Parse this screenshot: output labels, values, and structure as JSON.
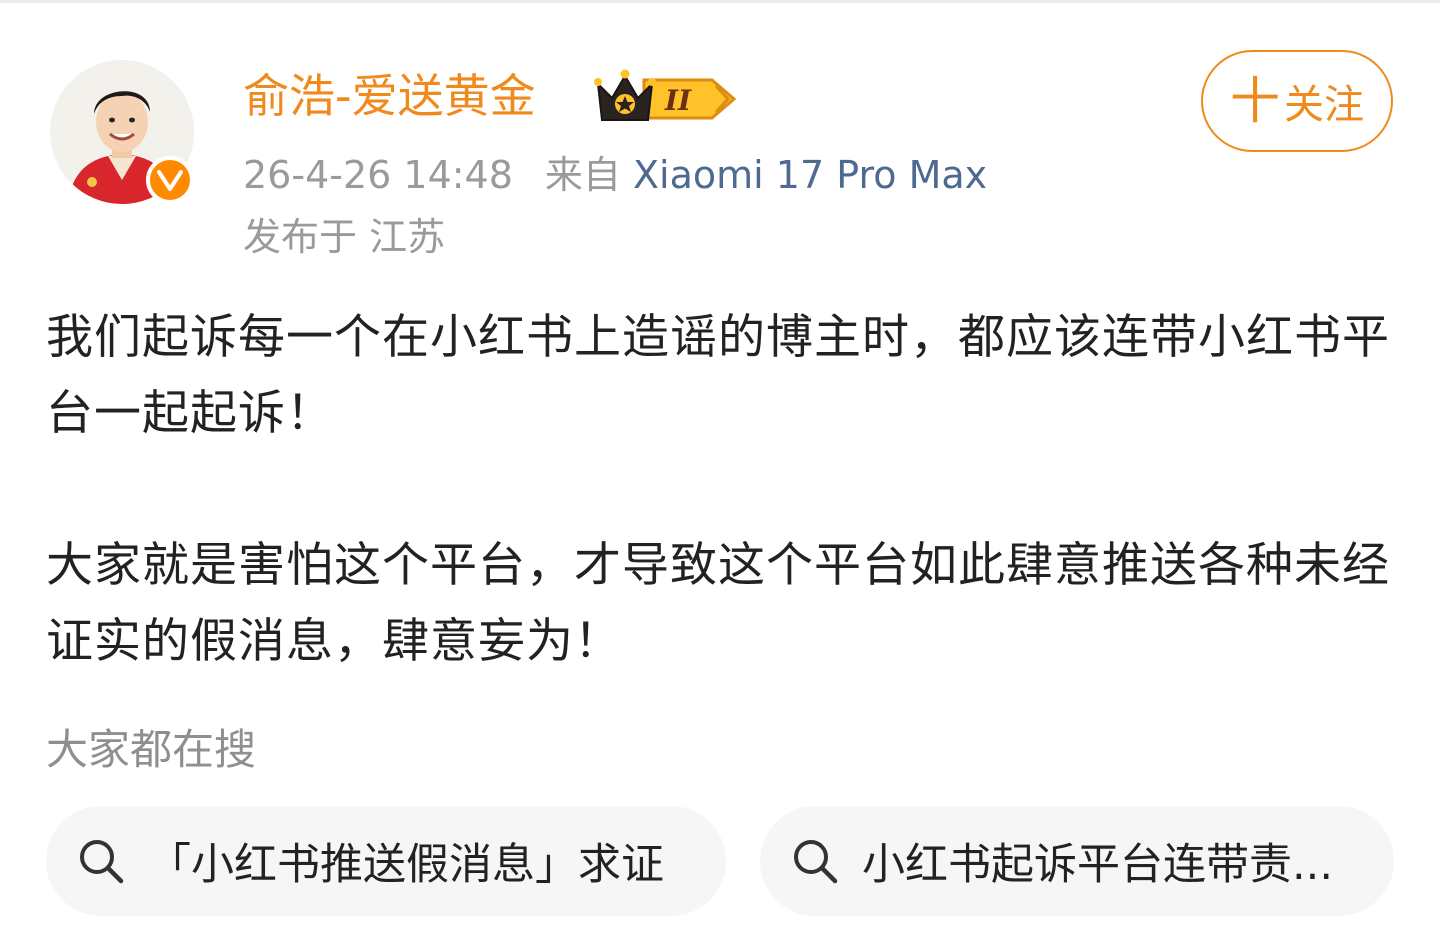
{
  "post": {
    "author": {
      "name": "俞浩-爱送黄金",
      "rank_badge_text": "II",
      "verified_icon": "v-verified-icon"
    },
    "meta": {
      "time": "26-4-26 14:48",
      "source_prefix": "来自",
      "device": "Xiaomi 17 Pro Max",
      "location": "发布于 江苏"
    },
    "follow_button": {
      "plus": "十",
      "label": "关注"
    },
    "paragraphs": [
      "我们起诉每一个在小红书上造谣的博主时，都应该连带小红书平台一起起诉！",
      "大家就是害怕这个平台，才导致这个平台如此肆意推送各种未经证实的假消息，肆意妄为！"
    ]
  },
  "search_section": {
    "title": "大家都在搜",
    "items": [
      "「小红书推送假消息」求证",
      "小红书起诉平台连带责..."
    ]
  },
  "colors": {
    "accent_orange": "#f08a1c",
    "device_blue": "#4e6a92",
    "meta_gray": "#9a9a9a",
    "body_text": "#222222",
    "chip_bg": "#f6f6f6"
  }
}
